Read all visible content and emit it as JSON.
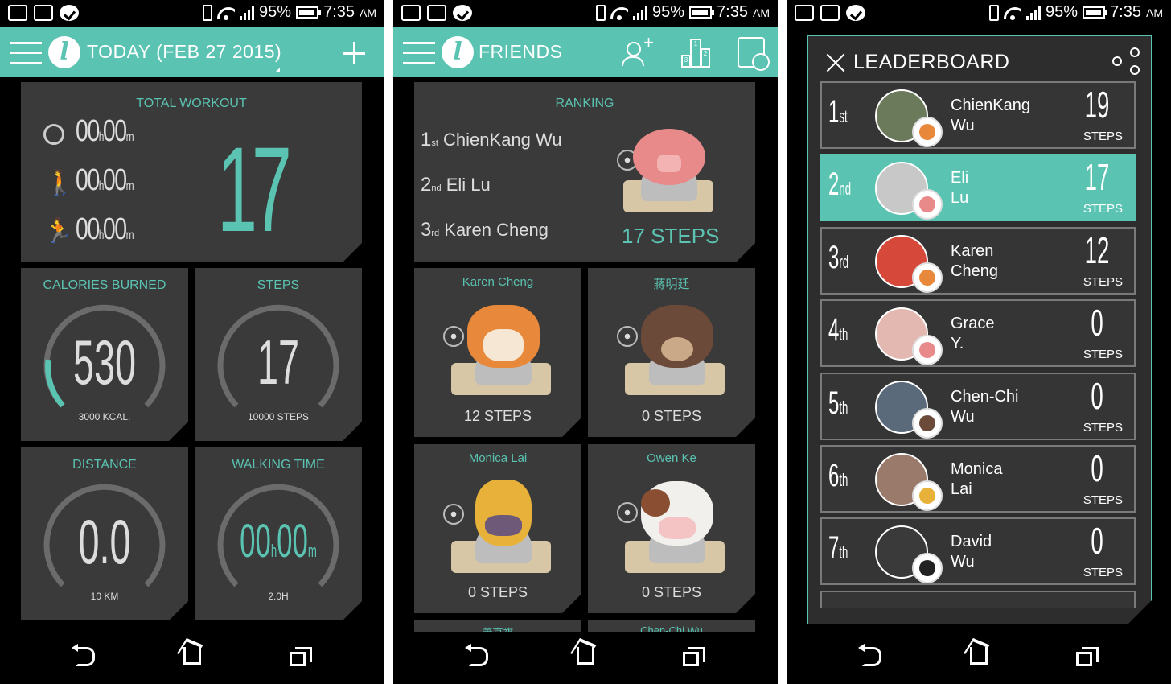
{
  "status": {
    "battery": "95%",
    "time": "7:35",
    "ampm": "AM"
  },
  "screen1": {
    "title": "TODAY (FEB 27 2015)",
    "total_workout": {
      "label": "TOTAL WORKOUT",
      "rows": [
        {
          "h": "00",
          "m": "00"
        },
        {
          "h": "00",
          "m": "00"
        },
        {
          "h": "00",
          "m": "00"
        }
      ],
      "value": "17"
    },
    "calories": {
      "label": "CALORIES BURNED",
      "value": "530",
      "sub": "3000 KCAL.",
      "progress": 0.18
    },
    "steps": {
      "label": "STEPS",
      "value": "17",
      "sub": "10000 STEPS",
      "progress": 0.0017
    },
    "distance": {
      "label": "DISTANCE",
      "value": "0.0",
      "sub": "10 KM",
      "progress": 0
    },
    "walking": {
      "label": "WALKING TIME",
      "h": "00",
      "m": "00",
      "sub": "2.0H",
      "progress": 0
    }
  },
  "screen2": {
    "title": "FRIENDS",
    "ranking": {
      "label": "RANKING",
      "entries": [
        {
          "n": "1",
          "sfx": "st",
          "name": "ChienKang Wu"
        },
        {
          "n": "2",
          "sfx": "nd",
          "name": "Eli Lu"
        },
        {
          "n": "3",
          "sfx": "rd",
          "name": "Karen Cheng"
        }
      ],
      "steps": "17 STEPS"
    },
    "friends": [
      {
        "name": "Karen Cheng",
        "steps": "12 STEPS",
        "animal": "dog"
      },
      {
        "name": "蔣明廷",
        "steps": "0 STEPS",
        "animal": "bear"
      },
      {
        "name": "Monica Lai",
        "steps": "0 STEPS",
        "animal": "llama"
      },
      {
        "name": "Owen Ke",
        "steps": "0 STEPS",
        "animal": "cow"
      }
    ],
    "partial": [
      "蕭亨祺",
      "Chen-Chi Wu"
    ]
  },
  "screen3": {
    "title": "LEADERBOARD",
    "rows": [
      {
        "n": "1",
        "sfx": "st",
        "first": "ChienKang",
        "last": "Wu",
        "steps": "19",
        "unit": "STEPS",
        "badge": "dog",
        "highlight": false
      },
      {
        "n": "2",
        "sfx": "nd",
        "first": "Eli",
        "last": "Lu",
        "steps": "17",
        "unit": "STEPS",
        "badge": "pig",
        "highlight": true
      },
      {
        "n": "3",
        "sfx": "rd",
        "first": "Karen",
        "last": "Cheng",
        "steps": "12",
        "unit": "STEPS",
        "badge": "dog",
        "highlight": false
      },
      {
        "n": "4",
        "sfx": "th",
        "first": "Grace",
        "last": "Y.",
        "steps": "0",
        "unit": "STEPS",
        "badge": "pig",
        "highlight": false
      },
      {
        "n": "5",
        "sfx": "th",
        "first": "Chen-Chi",
        "last": "Wu",
        "steps": "0",
        "unit": "STEPS",
        "badge": "bear",
        "highlight": false
      },
      {
        "n": "6",
        "sfx": "th",
        "first": "Monica",
        "last": "Lai",
        "steps": "0",
        "unit": "STEPS",
        "badge": "llama",
        "highlight": false
      },
      {
        "n": "7",
        "sfx": "th",
        "first": "David",
        "last": "Wu",
        "steps": "0",
        "unit": "STEPS",
        "badge": "panda",
        "highlight": false
      }
    ]
  },
  "colors": {
    "accent": "#5ac3b2",
    "card": "#3a3a3a",
    "pig": "#e88a8a",
    "dog": "#e8883a",
    "bear": "#6b4a3a"
  }
}
